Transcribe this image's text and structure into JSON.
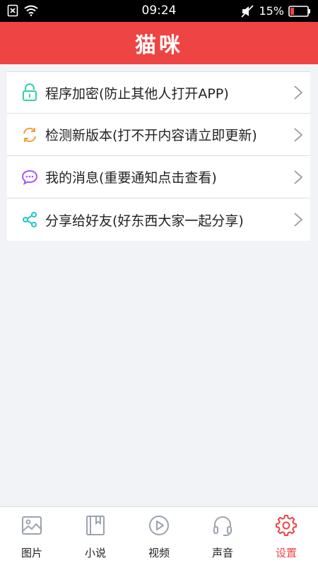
{
  "status_bar": {
    "time": "09:24",
    "battery": "15%"
  },
  "header": {
    "title": "猫咪"
  },
  "menu": [
    {
      "label": "程序加密(防止其他人打开APP)",
      "icon": "lock-icon",
      "color": "#2dd4a7"
    },
    {
      "label": "检测新版本(打不开内容请立即更新)",
      "icon": "refresh-icon",
      "color": "#f59e3b"
    },
    {
      "label": "我的消息(重要通知点击查看)",
      "icon": "message-icon",
      "color": "#a855f7"
    },
    {
      "label": "分享给好友(好东西大家一起分享)",
      "icon": "share-icon",
      "color": "#22c6c6"
    }
  ],
  "tabs": [
    {
      "label": "图片",
      "icon": "image-icon",
      "active": false
    },
    {
      "label": "小说",
      "icon": "book-icon",
      "active": false
    },
    {
      "label": "视频",
      "icon": "play-icon",
      "active": false
    },
    {
      "label": "声音",
      "icon": "headphones-icon",
      "active": false
    },
    {
      "label": "设置",
      "icon": "gear-icon",
      "active": true
    }
  ],
  "colors": {
    "accent": "#ef4444",
    "inactive_icon": "#9ca3af"
  }
}
